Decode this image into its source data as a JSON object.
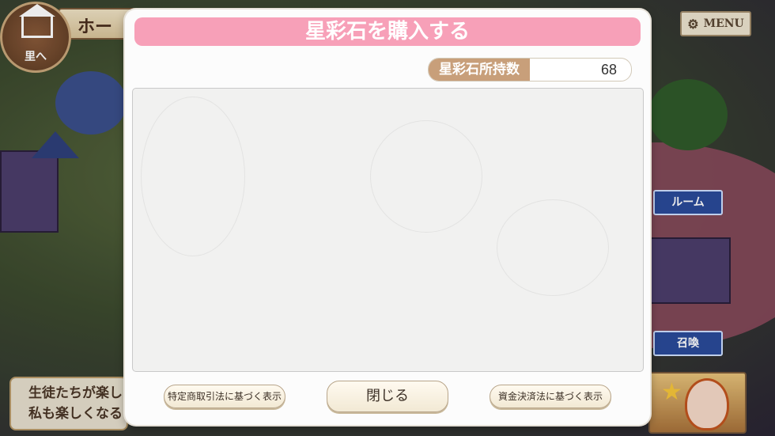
{
  "background": {
    "header_title": "ホー",
    "village_button_label": "里へ",
    "menu_label": "MENU",
    "room_label": "ルーム",
    "summon_label": "召喚",
    "message_line1": "生徒たちが楽し",
    "message_line2": "私も楽しくなる"
  },
  "modal": {
    "title": "星彩石を購入する",
    "owned_label": "星彩石所持数",
    "owned_value": "68",
    "buttons": {
      "commerce_law": "特定商取引法に基づく表示",
      "close": "閉じる",
      "payment_law": "資金決済法に基づく表示"
    }
  },
  "colors": {
    "title_bar": "#f7a0b8",
    "owned_label_bg": "#c89f7a"
  }
}
